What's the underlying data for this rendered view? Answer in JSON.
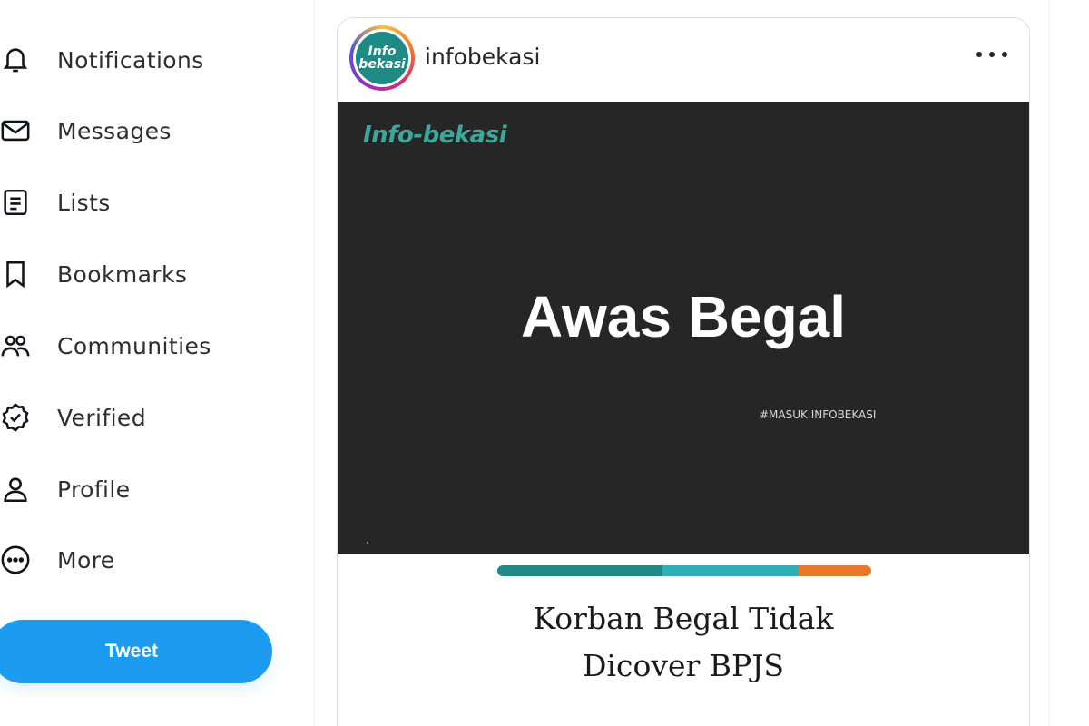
{
  "sidebar": {
    "items": [
      {
        "label": "Notifications",
        "icon": "bell-icon"
      },
      {
        "label": "Messages",
        "icon": "envelope-icon"
      },
      {
        "label": "Lists",
        "icon": "list-icon"
      },
      {
        "label": "Bookmarks",
        "icon": "bookmark-icon"
      },
      {
        "label": "Communities",
        "icon": "people-icon"
      },
      {
        "label": "Verified",
        "icon": "verified-badge-icon"
      },
      {
        "label": "Profile",
        "icon": "person-icon"
      },
      {
        "label": "More",
        "icon": "more-circle-icon"
      }
    ],
    "tweet_label": "Tweet"
  },
  "post": {
    "username": "infobekasi",
    "avatar_text": [
      "Info",
      "bekasi"
    ],
    "media": {
      "logo_text": "Info-bekasi",
      "headline": "Awas Begal",
      "hashtag": "#MASUK INFOBEKASI"
    },
    "caption_lines": [
      "Korban Begal Tidak",
      "Dicover BPJS"
    ]
  },
  "colors": {
    "accent": "#1d9bf0",
    "media_bg": "#262626",
    "teal_dark": "#1f8a86",
    "teal_light": "#2bb0b7",
    "orange": "#e9782b"
  }
}
